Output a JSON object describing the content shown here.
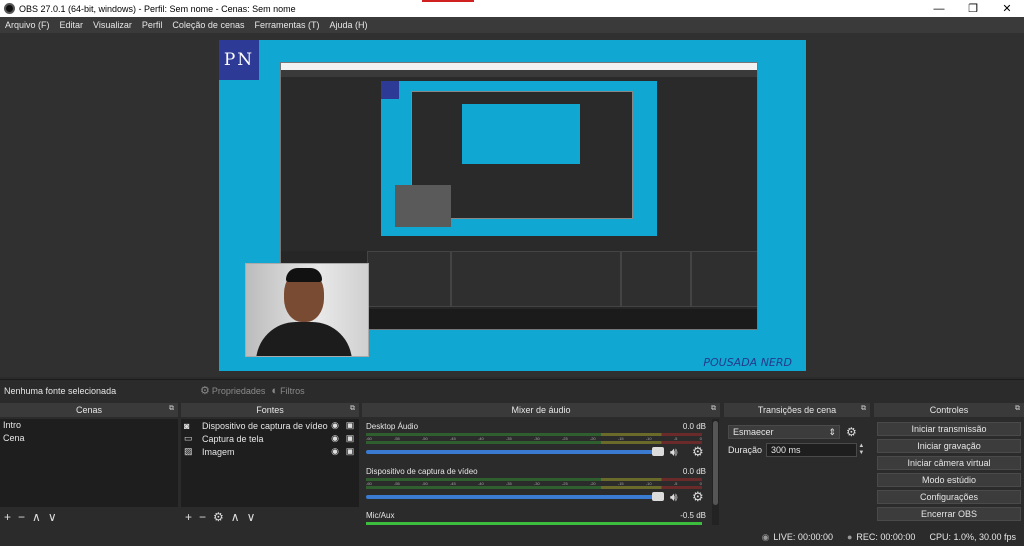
{
  "window": {
    "title": "OBS 27.0.1 (64-bit, windows) - Perfil: Sem nome - Cenas: Sem nome",
    "controls": [
      "—",
      "❐",
      "✕"
    ]
  },
  "menu": [
    "Arquivo (F)",
    "Editar",
    "Visualizar",
    "Perfil",
    "Coleção de cenas",
    "Ferramentas (T)",
    "Ajuda (H)"
  ],
  "preview": {
    "logo_text": "PN",
    "brand_text": "POUSADA NERD"
  },
  "sourcebar": {
    "no_source": "Nenhuma fonte selecionada",
    "properties_label": "Propriedades",
    "filters_label": "Filtros"
  },
  "scenes": {
    "title": "Cenas",
    "items": [
      "Intro",
      "Cena"
    ],
    "selected": "Intro",
    "footer": [
      "+",
      "−",
      "∧",
      "∨"
    ]
  },
  "sources": {
    "title": "Fontes",
    "items": [
      {
        "label": "Dispositivo de captura de vídeo",
        "icon": "camera-icon"
      },
      {
        "label": "Captura de tela",
        "icon": "monitor-icon"
      },
      {
        "label": "Imagem",
        "icon": "image-icon"
      }
    ],
    "footer": [
      "+",
      "−",
      "⚙",
      "∧",
      "∨"
    ]
  },
  "mixer": {
    "title": "Mixer de áudio",
    "channels": [
      {
        "name": "Desktop Áudio",
        "db": "0.0 dB"
      },
      {
        "name": "Dispositivo de captura de vídeo",
        "db": "0.0 dB"
      },
      {
        "name": "Mic/Aux",
        "db": "-0.5 dB"
      }
    ],
    "ticks": [
      "-60",
      "-55",
      "-50",
      "-45",
      "-40",
      "-35",
      "-30",
      "-25",
      "-20",
      "-15",
      "-10",
      "-5",
      "0"
    ]
  },
  "transitions": {
    "title": "Transições de cena",
    "selected": "Esmaecer",
    "duration_label": "Duração",
    "duration_value": "300 ms"
  },
  "controls": {
    "title": "Controles",
    "buttons": [
      "Iniciar transmissão",
      "Iniciar gravação",
      "Iniciar câmera virtual",
      "Modo estúdio",
      "Configurações",
      "Encerrar OBS"
    ]
  },
  "status": {
    "live": "LIVE: 00:00:00",
    "rec": "REC: 00:00:00",
    "cpu": "CPU: 1.0%, 30.00 fps"
  }
}
